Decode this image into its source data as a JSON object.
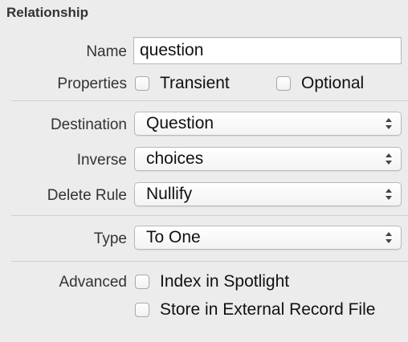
{
  "section": {
    "title": "Relationship"
  },
  "name": {
    "label": "Name",
    "value": "question"
  },
  "properties": {
    "label": "Properties",
    "transient_label": "Transient",
    "optional_label": "Optional"
  },
  "destination": {
    "label": "Destination",
    "value": "Question"
  },
  "inverse": {
    "label": "Inverse",
    "value": "choices"
  },
  "delete_rule": {
    "label": "Delete Rule",
    "value": "Nullify"
  },
  "type": {
    "label": "Type",
    "value": "To One"
  },
  "advanced": {
    "label": "Advanced",
    "index_spotlight_label": "Index in Spotlight",
    "external_record_label": "Store in External Record File"
  }
}
